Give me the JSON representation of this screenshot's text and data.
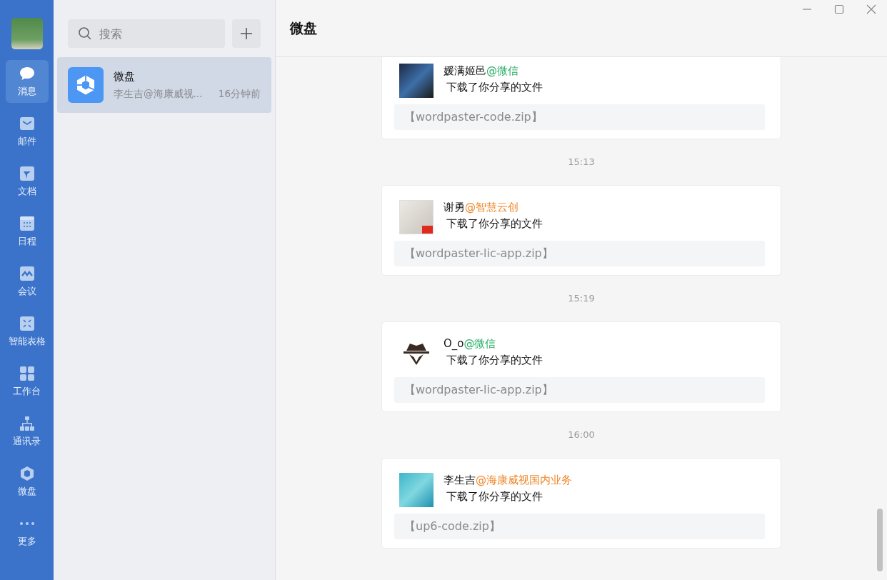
{
  "nav": {
    "items": [
      {
        "label": "消息",
        "selected": true
      },
      {
        "label": "邮件",
        "selected": false
      },
      {
        "label": "文档",
        "selected": false
      },
      {
        "label": "日程",
        "selected": false
      },
      {
        "label": "会议",
        "selected": false
      },
      {
        "label": "智能表格",
        "selected": false
      },
      {
        "label": "工作台",
        "selected": false
      },
      {
        "label": "通讯录",
        "selected": false
      },
      {
        "label": "微盘",
        "selected": false
      },
      {
        "label": "更多",
        "selected": false
      }
    ]
  },
  "conversations": {
    "search": {
      "placeholder": "搜索"
    },
    "items": [
      {
        "title": "微盘",
        "preview": "李生吉@海康威视...",
        "time": "16分钟前",
        "selected": true
      }
    ]
  },
  "chat": {
    "title": "微盘",
    "timeline": [
      {
        "kind": "message",
        "name": "媛满姬邑",
        "org": "@微信",
        "color": "#2aae67",
        "text": "下载了你分享的文件",
        "file": "【wordpaster-code.zip】"
      },
      {
        "kind": "time",
        "text": "15:13"
      },
      {
        "kind": "message",
        "name": "谢勇",
        "org": "@智慧云创",
        "color": "#f0872a",
        "text": "下载了你分享的文件",
        "file": "【wordpaster-lic-app.zip】"
      },
      {
        "kind": "time",
        "text": "15:19"
      },
      {
        "kind": "message",
        "name": "O_o",
        "org": "@微信",
        "color": "#2aae67",
        "text": "下载了你分享的文件",
        "file": "【wordpaster-lic-app.zip】"
      },
      {
        "kind": "time",
        "text": "16:00"
      },
      {
        "kind": "message",
        "name": "李生吉",
        "org": "@海康威视国内业务",
        "color": "#f0872a",
        "text": "下载了你分享的文件",
        "file": "【up6-code.zip】"
      }
    ]
  }
}
